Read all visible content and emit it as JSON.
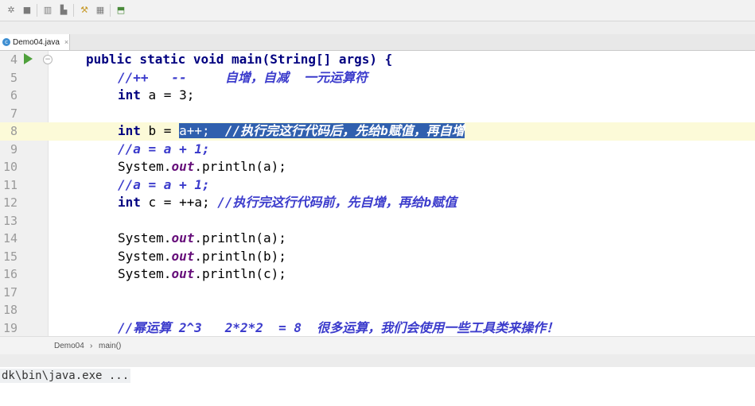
{
  "toolbar": {
    "icons": [
      "bug-icon",
      "stop-icon",
      "coverage-icon",
      "profile-icon",
      "tools-icon",
      "structure-icon",
      "vcs-icon"
    ]
  },
  "tab": {
    "title": "Demo04.java",
    "icon": "java-class-icon",
    "close": "×"
  },
  "editor": {
    "current_line": 8,
    "lines": [
      {
        "n": "4",
        "code": "public static void main(String[] args) {"
      },
      {
        "n": "5",
        "comment": "//++   --     自增，自减  一元运算符"
      },
      {
        "n": "6",
        "kw": "int",
        "rest": " a = 3;"
      },
      {
        "n": "7"
      },
      {
        "n": "8",
        "kw": "int",
        "rest": " b = ",
        "sel_code": "a++;  ",
        "sel_comment": "//执行完这行代码后，先给b赋值，再自增"
      },
      {
        "n": "9",
        "comment": "//a = a + 1;"
      },
      {
        "n": "10",
        "pre": "System.",
        "field": "out",
        "post": ".println(a);"
      },
      {
        "n": "11",
        "comment": "//a = a + 1;"
      },
      {
        "n": "12",
        "kw": "int",
        "rest": " c = ++a; ",
        "comment": "//执行完这行代码前，先自增，再给b赋值"
      },
      {
        "n": "13"
      },
      {
        "n": "14",
        "pre": "System.",
        "field": "out",
        "post": ".println(a);"
      },
      {
        "n": "15",
        "pre": "System.",
        "field": "out",
        "post": ".println(b);"
      },
      {
        "n": "16",
        "pre": "System.",
        "field": "out",
        "post": ".println(c);"
      },
      {
        "n": "17"
      },
      {
        "n": "18"
      },
      {
        "n": "19",
        "comment": "//幂运算 2^3   2*2*2  = 8  很多运算，我们会使用一些工具类来操作！"
      }
    ]
  },
  "breadcrumb": {
    "class_name": "Demo04",
    "separator": "›",
    "method": "main()"
  },
  "console": {
    "text": "dk\\bin\\java.exe ..."
  }
}
